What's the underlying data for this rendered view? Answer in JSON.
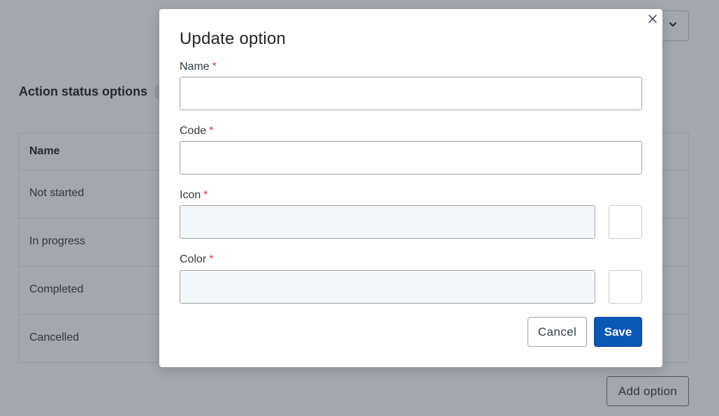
{
  "background": {
    "section_title": "Action status options",
    "table": {
      "column_header": "Name",
      "rows": [
        "Not started",
        "In progress",
        "Completed",
        "Cancelled"
      ]
    },
    "add_option_label": "Add option"
  },
  "modal": {
    "title": "Update option",
    "required_marker": "*",
    "fields": {
      "name": {
        "label": "Name",
        "value": ""
      },
      "code": {
        "label": "Code",
        "value": ""
      },
      "icon": {
        "label": "Icon",
        "value": ""
      },
      "color": {
        "label": "Color",
        "value": ""
      }
    },
    "cancel_label": "Cancel",
    "save_label": "Save"
  },
  "colors": {
    "primary": "#0b57b5",
    "required": "#dc3545",
    "overlay": "rgba(40,46,63,0.42)"
  },
  "icons": {
    "close": "close-icon",
    "select_toggle": "chevron-down-icon"
  }
}
